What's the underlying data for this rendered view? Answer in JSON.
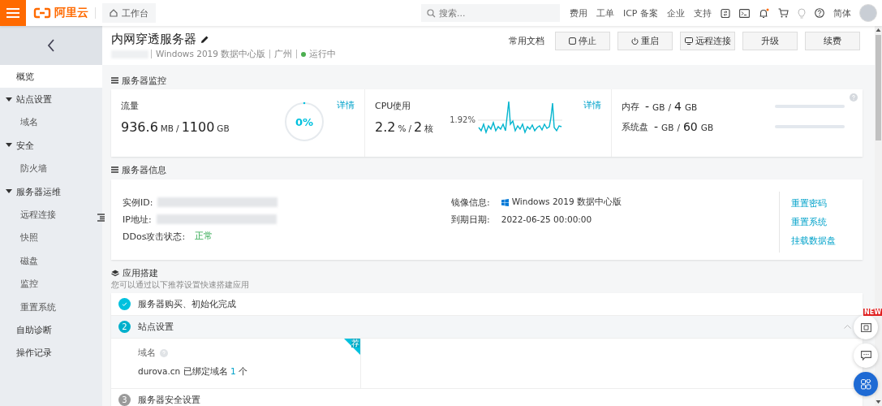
{
  "top_bar": {
    "logo": "阿里云",
    "workbench": "工作台",
    "search": {
      "placeholder": "搜索..."
    },
    "links": [
      "费用",
      "工单",
      "ICP 备案",
      "企业",
      "支持"
    ],
    "language": "简体"
  },
  "sidebar": {
    "items": [
      {
        "label": "概览",
        "selected": true
      },
      {
        "label": "站点设置",
        "selected": false,
        "expanded": true,
        "children": [
          {
            "label": "域名",
            "selected": false
          }
        ]
      },
      {
        "label": "安全",
        "selected": false,
        "expanded": true,
        "children": [
          {
            "label": "防火墙",
            "selected": false
          }
        ]
      },
      {
        "label": "服务器运维",
        "selected": false,
        "expanded": true,
        "children": [
          {
            "label": "远程连接",
            "selected": false
          },
          {
            "label": "快照",
            "selected": false
          },
          {
            "label": "磁盘",
            "selected": false
          },
          {
            "label": "监控",
            "selected": false
          },
          {
            "label": "重置系统",
            "selected": false
          }
        ]
      },
      {
        "label": "自助诊断",
        "selected": false
      },
      {
        "label": "操作记录",
        "selected": false
      }
    ]
  },
  "header": {
    "title": "内网穿透服务器",
    "os": "Windows 2019 数据中心版",
    "region": "广州",
    "status": "运行中",
    "doc_link": "常用文档",
    "buttons": [
      {
        "kind": "stop",
        "label": "停止"
      },
      {
        "kind": "restart",
        "label": "重启"
      },
      {
        "kind": "remote",
        "label": "远程连接"
      },
      {
        "kind": "plain",
        "label": "升级"
      },
      {
        "kind": "plain",
        "label": "续费"
      }
    ]
  },
  "monitor": {
    "title": "服务器监控",
    "traffic": {
      "label": "流量",
      "used": "936.6",
      "used_unit": "MB",
      "separator": "/",
      "total": "1100",
      "total_unit": "GB",
      "percent": "0%",
      "level": 0,
      "detail": "详情"
    },
    "cpu": {
      "label": "CPU使用",
      "used": "2.2",
      "used_unit": "%",
      "separator": "/",
      "total": "2",
      "total_unit": "核",
      "peak": "1.92%",
      "detail": "详情"
    },
    "storage": [
      {
        "label": "内存",
        "used": "-",
        "used_unit": "GB",
        "separator": "/",
        "total": "4",
        "total_unit": "GB",
        "level": 0
      },
      {
        "label": "系统盘",
        "used": "-",
        "used_unit": "GB",
        "separator": "/",
        "total": "60",
        "total_unit": "GB",
        "level": 0
      }
    ]
  },
  "info": {
    "title": "服务器信息",
    "left": [
      {
        "kind": "redacted",
        "label": "实例ID:"
      },
      {
        "kind": "redacted",
        "label": "IP地址:"
      },
      {
        "kind": "status",
        "label": "DDos攻击状态:",
        "value": "正常"
      }
    ],
    "right": [
      {
        "kind": "os",
        "label": "镜像信息:",
        "value": "Windows 2019 数据中心版"
      },
      {
        "kind": "text",
        "label": "到期日期:",
        "value": "2022-06-25 00:00:00"
      }
    ],
    "links": [
      "重置密码",
      "重置系统",
      "挂载数据盘"
    ]
  },
  "app": {
    "title": "应用搭建",
    "hint": "您可以通过以下推荐设置快速搭建应用",
    "steps": [
      {
        "kind": "done",
        "label": "服务器购买、初始化完成",
        "expanded": false
      },
      {
        "kind": "active",
        "number": "2",
        "label": "站点设置",
        "expanded": true,
        "field_label": "域名",
        "domain": "durova.cn",
        "bound_text": "已绑定域名",
        "count": "1",
        "count_unit": "个",
        "badge": "荐"
      },
      {
        "kind": "pending",
        "number": "3",
        "label": "服务器安全设置",
        "expanded": false
      }
    ]
  },
  "float_tools": {
    "new_badge": "NEW"
  }
}
